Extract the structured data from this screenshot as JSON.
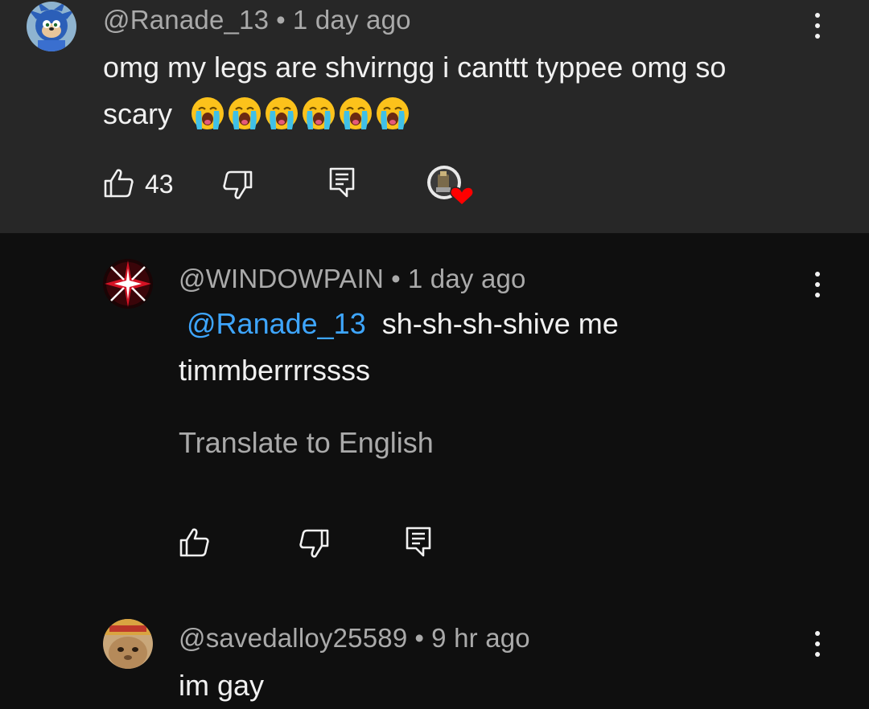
{
  "comments": [
    {
      "username": "@Ranade_13",
      "separator": "•",
      "time": "1 day ago",
      "line1": "omg my legs are shvirngg i canttt typpee omg so",
      "line2": "scary",
      "emoji_count": 6,
      "emoji_name": "loudly-crying-face",
      "like_count": "43",
      "hearted_by_creator": true
    },
    {
      "username": "@WINDOWPAIN",
      "separator": "•",
      "time": "1 day ago",
      "mention": "@Ranade_13",
      "line1": "sh-sh-sh-shive me",
      "line2": "timmberrrrssss",
      "translate_label": "Translate to English"
    },
    {
      "username": "@savedalloy25589",
      "separator": "•",
      "time": "9 hr ago",
      "line1": "im gay"
    }
  ],
  "icons": {
    "like": "thumbs-up-icon",
    "dislike": "thumbs-down-icon",
    "reply": "reply-icon",
    "more": "more-vert-icon",
    "heart": "creator-heart-icon"
  },
  "colors": {
    "highlight_bg": "#272727",
    "page_bg": "#0f0f0f",
    "mention": "#3ea6ff",
    "heart": "#ff0000",
    "meta": "#aaaaaa"
  }
}
